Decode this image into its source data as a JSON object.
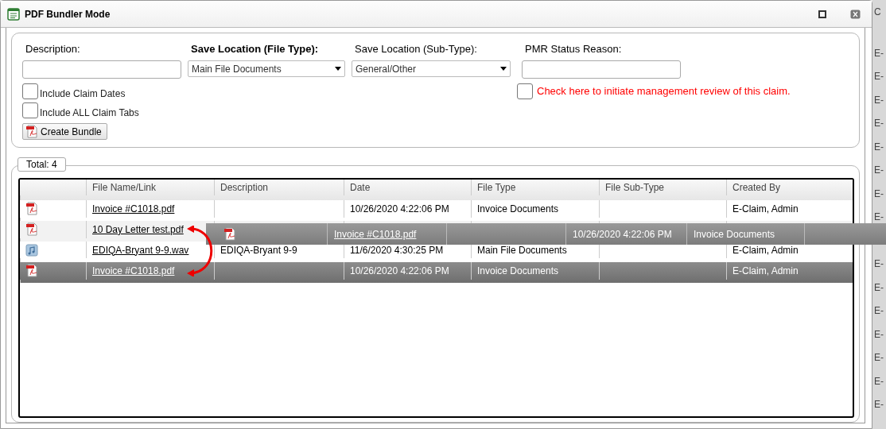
{
  "window": {
    "title": "PDF Bundler Mode"
  },
  "form": {
    "description": {
      "label": "Description:"
    },
    "file_type": {
      "label": "Save Location (File Type):",
      "value": "Main File Documents"
    },
    "sub_type": {
      "label": "Save Location (Sub-Type):",
      "value": "General/Other"
    },
    "pmr": {
      "label": "PMR Status Reason:"
    },
    "options": [
      {
        "label": "Include Claim Dates",
        "checked": false
      },
      {
        "label": "Include ALL Claim Tabs",
        "checked": false
      }
    ],
    "review": {
      "label": "Check here to initiate management review of this claim.",
      "checked": false
    },
    "create_button": "Create Bundle"
  },
  "total": "Total: 4",
  "table": {
    "columns": [
      "File Name/Link",
      "Description",
      "Date",
      "File Type",
      "File Sub-Type",
      "Created By"
    ],
    "rows": [
      {
        "kind": "pdf",
        "file": "Invoice #C1018.pdf",
        "description": "",
        "date": "10/26/2020 4:22:06 PM",
        "file_type": "Invoice Documents",
        "sub_type": "",
        "created_by": "E-Claim, Admin",
        "selected": false
      },
      {
        "kind": "pdf",
        "file": "10 Day Letter test.pdf",
        "description": "",
        "date": "",
        "file_type": "",
        "sub_type": "",
        "created_by": "",
        "selected": false
      },
      {
        "kind": "audio",
        "file": "EDIQA-Bryant 9-9.wav",
        "description": "EDIQA-Bryant 9-9",
        "date": "11/6/2020 4:30:25 PM",
        "file_type": "Main File Documents",
        "sub_type": "",
        "created_by": "E-Claim, Admin",
        "selected": false
      },
      {
        "kind": "pdf",
        "file": "Invoice #C1018.pdf",
        "description": "",
        "date": "10/26/2020 4:22:06 PM",
        "file_type": "Invoice Documents",
        "sub_type": "",
        "created_by": "E-Claim, Admin",
        "selected": true
      }
    ]
  },
  "drag_preview": {
    "kind": "pdf",
    "file": "Invoice #C1018.pdf",
    "date": "10/26/2020 4:22:06 PM",
    "file_type": "Invoice Documents"
  },
  "background_column": {
    "header": "C",
    "cells": [
      "E-",
      "E-",
      "E-",
      "E-",
      "E-",
      "E-",
      "E-",
      "E-",
      "E-",
      "E-",
      "E-",
      "E-",
      "E-",
      "E-",
      "E-"
    ]
  }
}
